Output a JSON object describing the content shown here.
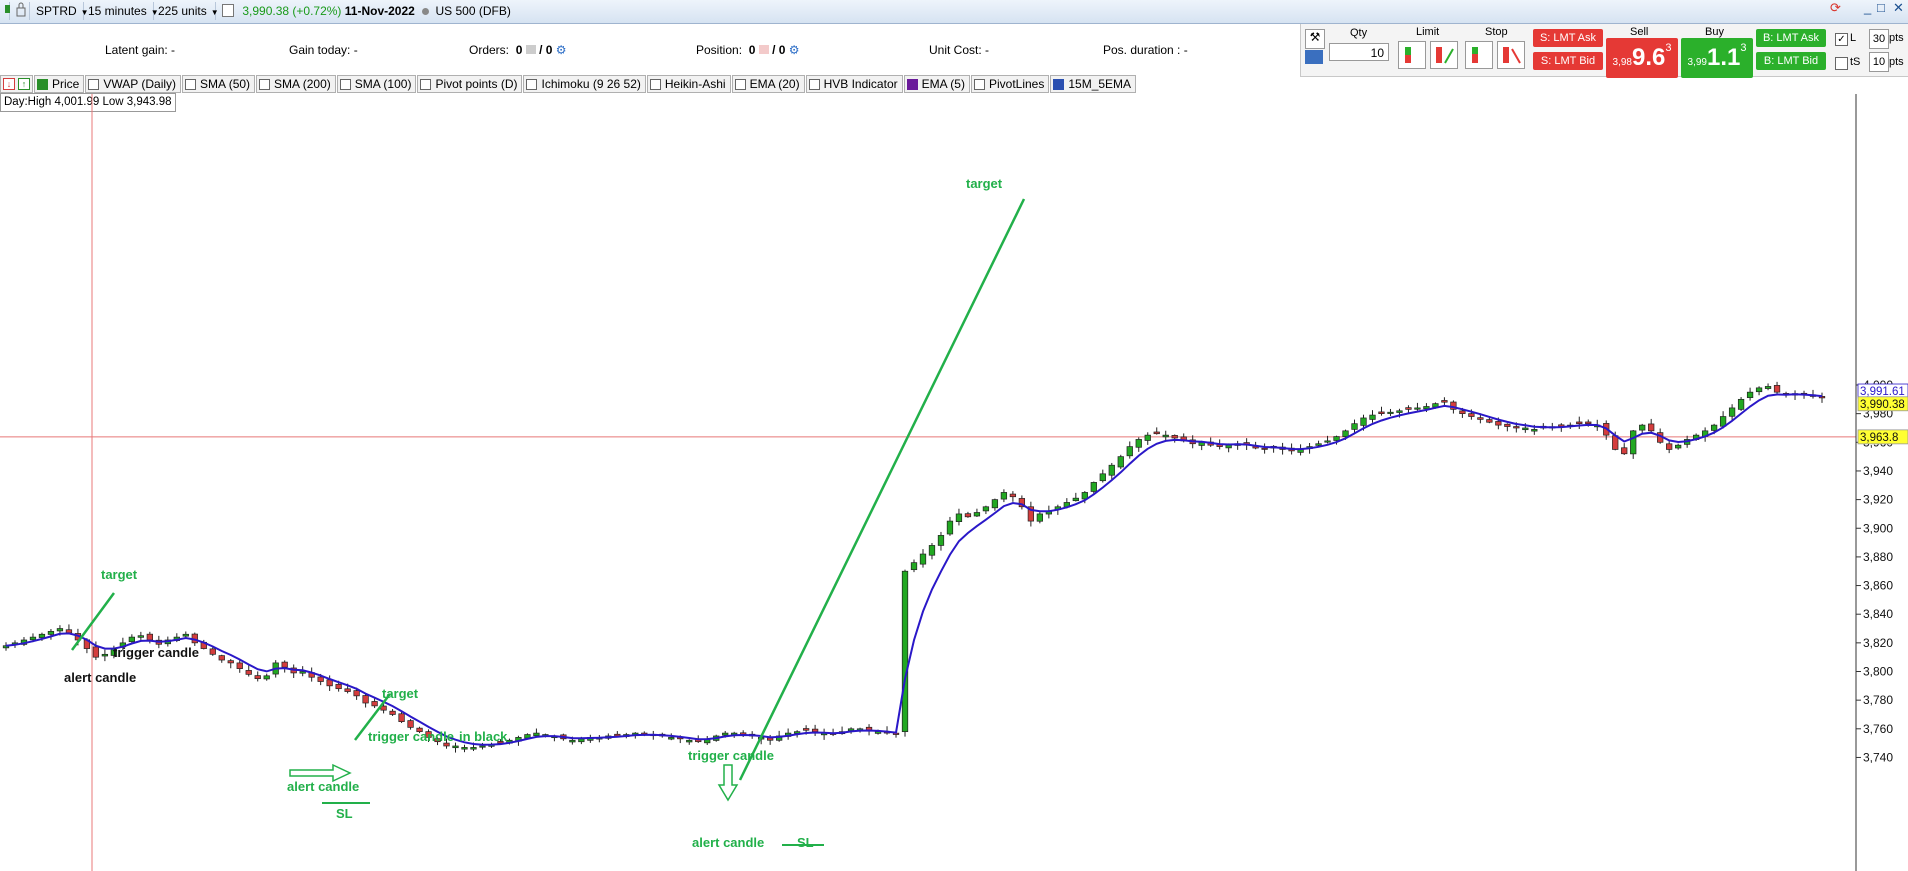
{
  "toolbar": {
    "symbol": "SPTRD",
    "timeframe": "15 minutes",
    "units": "225 units",
    "price_change": "3,990.38 (+0.72%)",
    "date": "11-Nov-2022",
    "instrument": "US 500 (DFB)"
  },
  "info": {
    "latent_gain": "Latent gain:  -",
    "gain_today": "Gain today:  -",
    "orders_label": "Orders:",
    "orders_val": "0",
    "orders_val2": "/ 0",
    "position_label": "Position:",
    "position_val": "0",
    "position_val2": "/ 0",
    "unit_cost": "Unit Cost:  -",
    "pos_duration": "Pos. duration :  -"
  },
  "trade": {
    "qty_label": "Qty",
    "qty_value": "10",
    "limit_label": "Limit",
    "stop_label": "Stop",
    "sell_label": "Sell",
    "buy_label": "Buy",
    "s_lmt_ask": "S: LMT Ask",
    "s_lmt_bid": "S: LMT Bid",
    "b_lmt_ask": "B: LMT Ask",
    "b_lmt_bid": "B: LMT Bid",
    "sell_prefix": "3,98",
    "sell_big": "9.6",
    "sell_sup": "3",
    "buy_prefix": "3,99",
    "buy_big": "1.1",
    "buy_sup": "3",
    "l_label": "L",
    "ts_label": "tS",
    "pts1_val": "30",
    "pts2_val": "10",
    "pts_label": "pts",
    "pts_label2": "pts"
  },
  "indicators": [
    "Price",
    "VWAP (Daily)",
    "SMA (50)",
    "SMA (200)",
    "SMA (100)",
    "Pivot points (D)",
    "Ichimoku (9 26 52)",
    "Heikin-Ashi",
    "EMA (20)",
    "HVB Indicator",
    "EMA (5)",
    "PivotLines",
    "15M_5EMA"
  ],
  "day_hl": "Day:High 4,001.99 Low 3,943.98",
  "colors": {
    "bull": "#22a822",
    "bear": "#d43d3d",
    "ema": "#2a18c8",
    "annot": "#22b04a",
    "crosshair": "#e87878",
    "label_bg": "#ffff33"
  },
  "chart_data": {
    "type": "candlestick",
    "ylim": [
      3737,
      4007
    ],
    "yticks": [
      "3,740",
      "3,760",
      "3,780",
      "3,800",
      "3,820",
      "3,840",
      "3,860",
      "3,880",
      "3,900",
      "3,920",
      "3,940",
      "3,960",
      "3,980",
      "4,000"
    ],
    "price_labels": [
      "3,991.61",
      "3,990.38",
      "3,963.8"
    ],
    "price_label_values": [
      3991.61,
      3990.38,
      3963.8
    ],
    "closes": [
      3818,
      3820,
      3822,
      3824,
      3826,
      3828,
      3830,
      3827,
      3822,
      3816,
      3810,
      3812,
      3816,
      3820,
      3824,
      3825,
      3822,
      3819,
      3822,
      3824,
      3826,
      3820,
      3816,
      3812,
      3808,
      3806,
      3802,
      3798,
      3795,
      3797,
      3806,
      3803,
      3799,
      3800,
      3796,
      3793,
      3790,
      3788,
      3786,
      3783,
      3778,
      3776,
      3773,
      3770,
      3765,
      3761,
      3758,
      3754,
      3751,
      3748,
      3748,
      3747,
      3747,
      3748,
      3749,
      3750,
      3752,
      3754,
      3756,
      3757,
      3756,
      3755,
      3753,
      3752,
      3753,
      3754,
      3754,
      3755,
      3755,
      3756,
      3757,
      3756,
      3756,
      3755,
      3754,
      3753,
      3752,
      3751,
      3753,
      3755,
      3757,
      3757,
      3756,
      3755,
      3754,
      3752,
      3755,
      3757,
      3758,
      3759,
      3758,
      3757,
      3756,
      3758,
      3760,
      3760,
      3759,
      3758,
      3757,
      3756,
      3870,
      3876,
      3882,
      3888,
      3895,
      3905,
      3910,
      3908,
      3911,
      3915,
      3920,
      3925,
      3922,
      3915,
      3905,
      3910,
      3912,
      3915,
      3918,
      3921,
      3925,
      3932,
      3938,
      3944,
      3950,
      3957,
      3962,
      3965,
      3966,
      3965,
      3963,
      3961,
      3959,
      3960,
      3958,
      3957,
      3958,
      3959,
      3958,
      3956,
      3955,
      3956,
      3955,
      3954,
      3955,
      3957,
      3959,
      3961,
      3964,
      3968,
      3973,
      3977,
      3979,
      3980,
      3981,
      3982,
      3983,
      3984,
      3985,
      3987,
      3988,
      3983,
      3980,
      3978,
      3976,
      3974,
      3972,
      3971,
      3970,
      3970,
      3969,
      3970,
      3970,
      3971,
      3972,
      3973,
      3973,
      3972,
      3965,
      3955,
      3952,
      3968,
      3972,
      3968,
      3960,
      3955,
      3958,
      3962,
      3965,
      3968,
      3972,
      3978,
      3984,
      3990,
      3995,
      3998,
      3999,
      3995,
      3993,
      3994,
      3993,
      3992,
      3991
    ],
    "annotations": [
      {
        "text": "target",
        "value": 3836,
        "color": "green"
      },
      {
        "text": "alert candle",
        "value": 3799,
        "color": "black"
      },
      {
        "text": "trigger candle",
        "value": 3807,
        "color": "black"
      },
      {
        "text": "target",
        "value": 3792,
        "color": "green"
      },
      {
        "text": "trigger candle",
        "value": 3777,
        "color": "green"
      },
      {
        "text": "in black",
        "value": 3777,
        "color": "green"
      },
      {
        "text": "alert candle",
        "value": 3761,
        "color": "green"
      },
      {
        "text": "SL",
        "value": 3752,
        "color": "green"
      },
      {
        "text": "trigger candle",
        "value": 3765,
        "color": "green"
      },
      {
        "text": "alert candle",
        "value": 3742,
        "color": "green"
      },
      {
        "text": "SL",
        "value": 3741,
        "color": "green"
      },
      {
        "text": "target",
        "value": 3960,
        "color": "green"
      }
    ]
  }
}
